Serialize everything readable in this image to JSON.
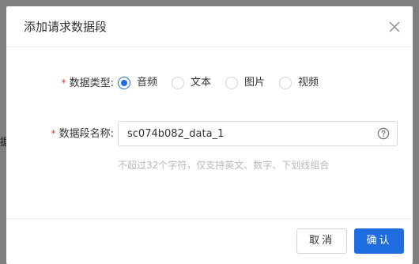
{
  "backdrop": {
    "edge_text": "据"
  },
  "dialog": {
    "title": "添加请求数据段",
    "close_icon": "close-icon"
  },
  "form": {
    "type_field": {
      "required_mark": "*",
      "label": "数据类型:",
      "options": [
        {
          "label": "音频",
          "checked": true
        },
        {
          "label": "文本",
          "checked": false
        },
        {
          "label": "图片",
          "checked": false
        },
        {
          "label": "视频",
          "checked": false
        }
      ]
    },
    "name_field": {
      "required_mark": "*",
      "label": "数据段名称:",
      "value": "sc074b082_data_1",
      "help_icon": "question-circle-icon",
      "hint": "不超过32个字符，仅支持英文、数字、下划线组合"
    }
  },
  "footer": {
    "cancel_label": "取消",
    "confirm_label": "确认"
  },
  "colors": {
    "primary": "#1e6de0",
    "required": "#e4393c",
    "overlay": "#7f7f7f"
  }
}
